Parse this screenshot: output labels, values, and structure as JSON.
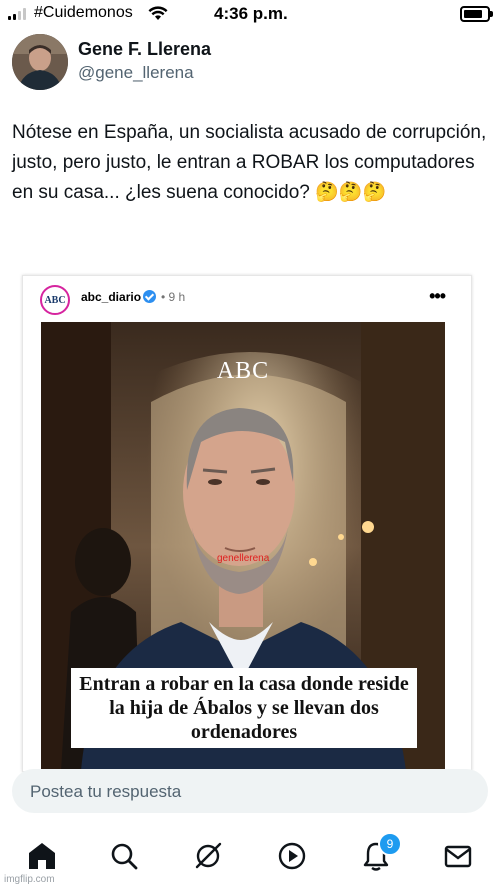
{
  "status_bar": {
    "carrier": "#Cuidemonos",
    "time": "4:36 p.m."
  },
  "author": {
    "name": "Gene F. Llerena",
    "handle": "@gene_llerena",
    "avatar_icon": "avatar-photo"
  },
  "tweet": {
    "text": "Nótese en España, un socialista acusado de corrupción, justo, pero justo, le entran a ROBAR los computadores en su casa... ¿les suena conocido? 🤔🤔🤔"
  },
  "embedded_post": {
    "account": "abc_diario",
    "logo_text": "ABC",
    "time": "• 9 h",
    "more": "•••",
    "image_brand": "ABC",
    "watermark": "genellerena",
    "headline": "Entran a robar en la casa donde reside la hija de Ábalos y se llevan dos ordenadores"
  },
  "reply": {
    "placeholder": "Postea tu respuesta"
  },
  "bottom_nav": {
    "items": [
      "home-icon",
      "search-icon",
      "grok-icon",
      "video-icon",
      "notifications-icon",
      "messages-icon"
    ],
    "notification_count": "9"
  },
  "footer": {
    "watermark": "imgflip.com"
  },
  "colors": {
    "accent": "#1d9bf0",
    "text": "#0f1419",
    "secondary_text": "#536471"
  }
}
